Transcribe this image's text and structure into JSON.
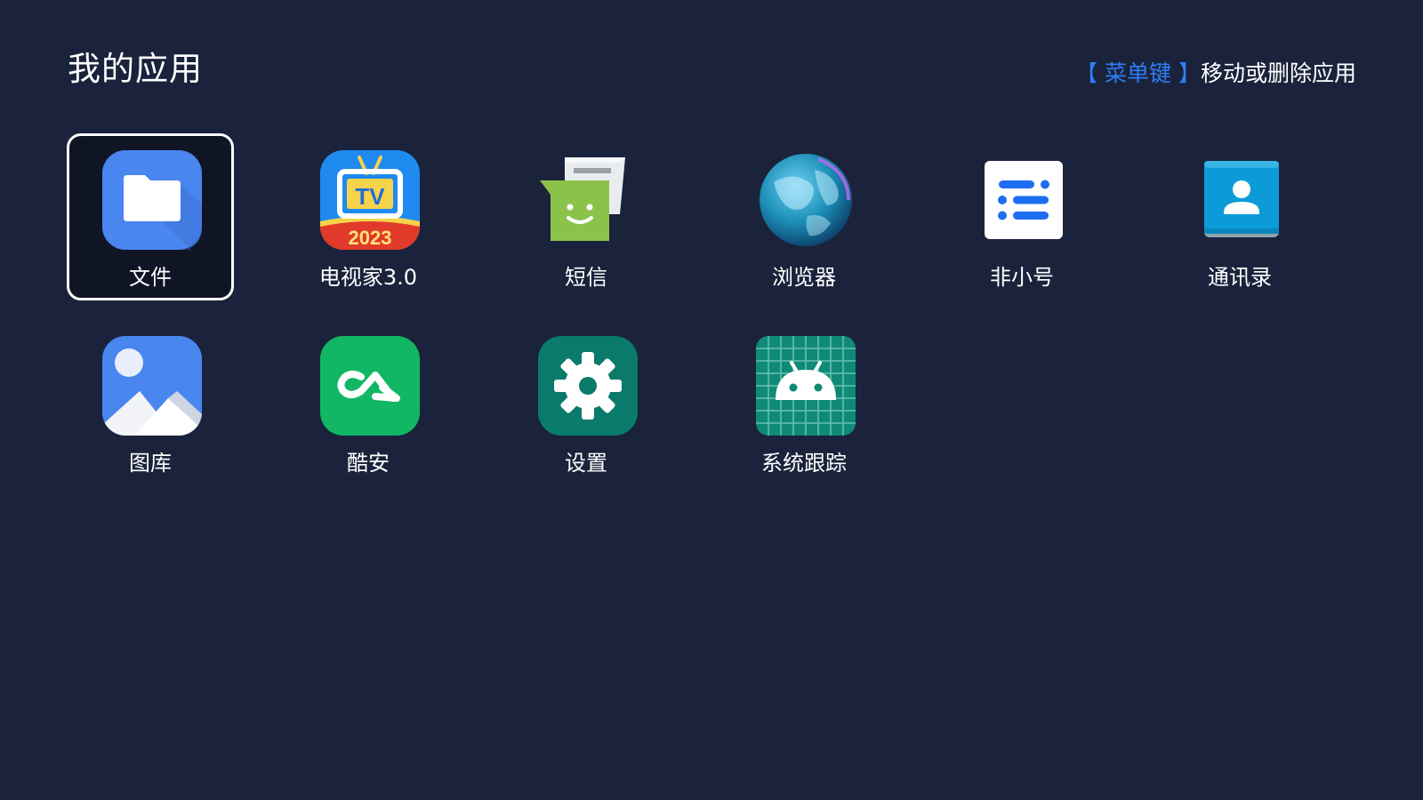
{
  "header": {
    "title": "我的应用",
    "hint_key": "【 菜单键 】",
    "hint_text": "移动或删除应用"
  },
  "apps": [
    {
      "label": "文件",
      "icon": "folder-icon",
      "focused": true
    },
    {
      "label": "电视家3.0",
      "icon": "tv-app-icon",
      "focused": false
    },
    {
      "label": "短信",
      "icon": "messaging-icon",
      "focused": false
    },
    {
      "label": "浏览器",
      "icon": "globe-icon",
      "focused": false
    },
    {
      "label": "非小号",
      "icon": "feixiaohao-icon",
      "focused": false
    },
    {
      "label": "通讯录",
      "icon": "contacts-icon",
      "focused": false
    },
    {
      "label": "图库",
      "icon": "gallery-icon",
      "focused": false
    },
    {
      "label": "酷安",
      "icon": "coolapk-icon",
      "focused": false
    },
    {
      "label": "设置",
      "icon": "gear-icon",
      "focused": false
    },
    {
      "label": "系统跟踪",
      "icon": "android-icon",
      "focused": false
    }
  ],
  "icon_text": {
    "tv_year": "2023"
  },
  "colors": {
    "background": "#1a233b",
    "accent": "#2f7df6",
    "focus_border": "#ffffff"
  }
}
